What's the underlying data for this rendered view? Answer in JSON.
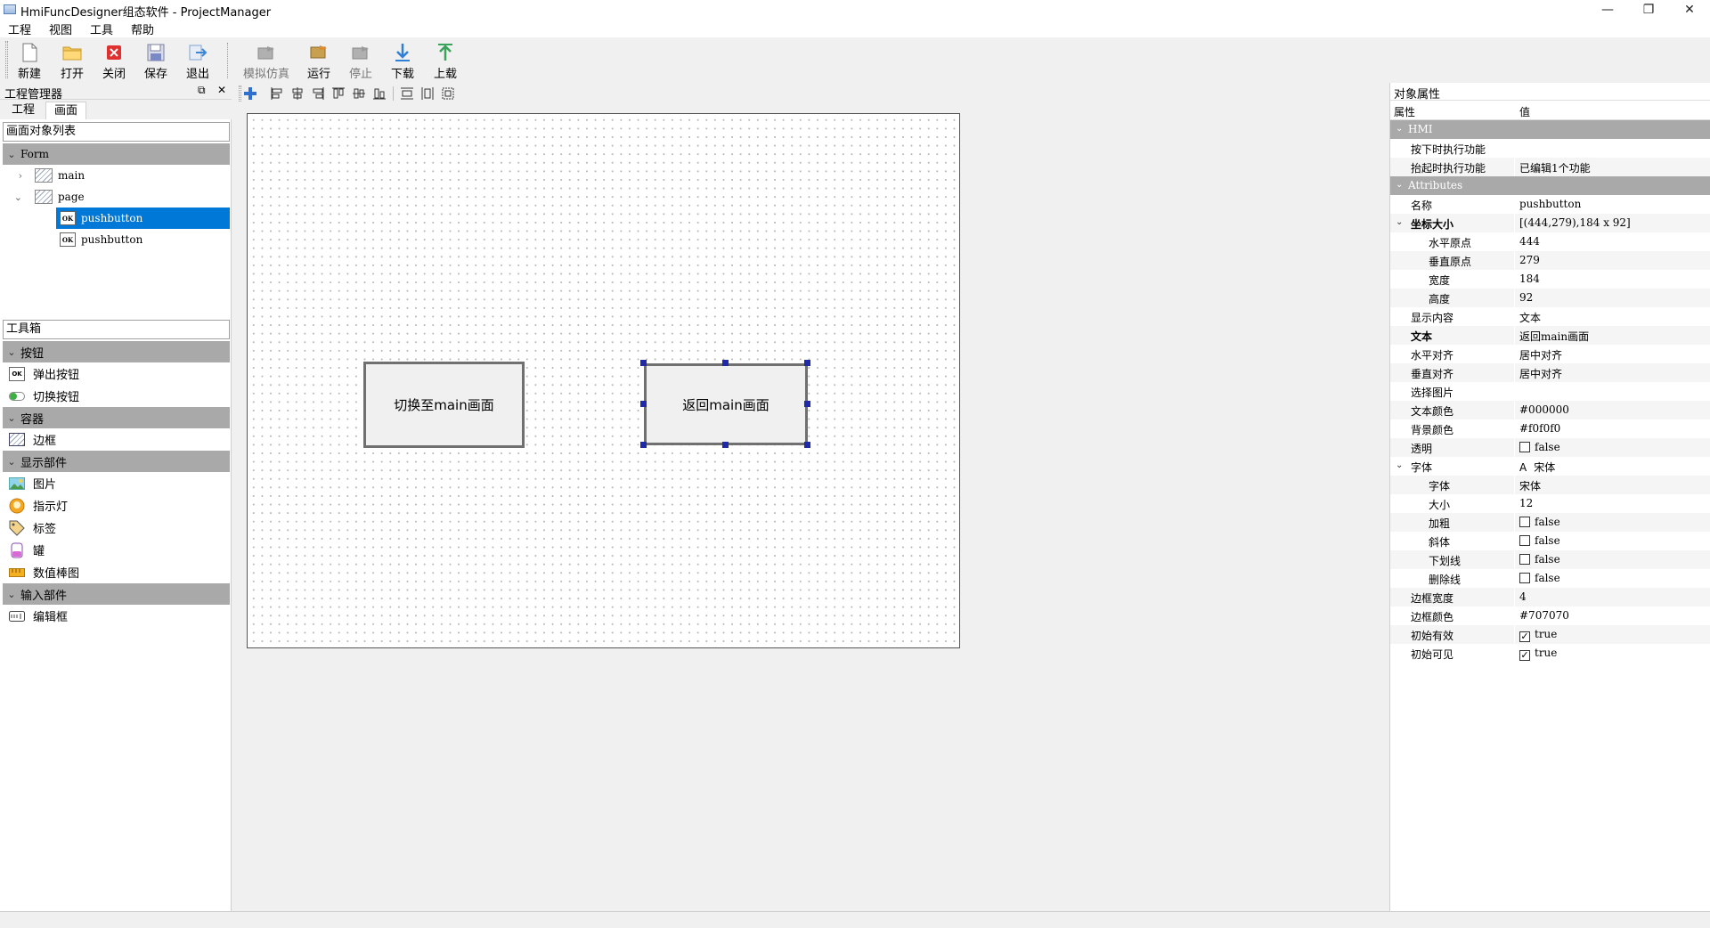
{
  "window": {
    "title": "HmiFuncDesigner组态软件 - ProjectManager",
    "controls": {
      "minimize": "—",
      "maximize": "❐",
      "close": "✕"
    }
  },
  "menu": [
    "工程",
    "视图",
    "工具",
    "帮助"
  ],
  "toolbar": {
    "new": "新建",
    "open": "打开",
    "close": "关闭",
    "save": "保存",
    "exit": "退出",
    "simulate": "模拟仿真",
    "run": "运行",
    "stop": "停止",
    "download": "下载",
    "upload": "上载"
  },
  "left": {
    "dock_title": "工程管理器",
    "dock_float_icon": "⧉",
    "dock_close_icon": "✕",
    "tabs": [
      "工程",
      "画面"
    ],
    "object_list_header": "画面对象列表",
    "tree": {
      "root": "Form",
      "items": [
        {
          "label": "main",
          "expanded": false
        },
        {
          "label": "page",
          "expanded": true,
          "children": [
            "pushbutton",
            "pushbutton"
          ]
        }
      ]
    },
    "toolbox_header": "工具箱",
    "groups": {
      "buttons": {
        "title": "按钮",
        "items": [
          "弹出按钮",
          "切换按钮"
        ]
      },
      "containers": {
        "title": "容器",
        "items": [
          "边框"
        ]
      },
      "display": {
        "title": "显示部件",
        "items": [
          "图片",
          "指示灯",
          "标签",
          "罐",
          "数值棒图"
        ]
      },
      "input": {
        "title": "输入部件",
        "items": [
          "编辑框"
        ]
      }
    }
  },
  "canvas": {
    "buttons": [
      {
        "text": "切换至main画面",
        "selected": false
      },
      {
        "text": "返回main画面",
        "selected": true
      }
    ]
  },
  "right": {
    "title": "对象属性",
    "col_property": "属性",
    "col_value": "值",
    "groups": {
      "hmi": "HMI",
      "attributes": "Attributes"
    },
    "props": {
      "press_func": {
        "k": "按下时执行功能",
        "v": ""
      },
      "release_func": {
        "k": "抬起时执行功能",
        "v": "已编辑1个功能"
      },
      "name": {
        "k": "名称",
        "v": "pushbutton"
      },
      "geometry": {
        "k": "坐标大小",
        "v": "[(444,279),184 x 92]"
      },
      "x": {
        "k": "水平原点",
        "v": "444"
      },
      "y": {
        "k": "垂直原点",
        "v": "279"
      },
      "width": {
        "k": "宽度",
        "v": "184"
      },
      "height": {
        "k": "高度",
        "v": "92"
      },
      "show_content": {
        "k": "显示内容",
        "v": "文本"
      },
      "text": {
        "k": "文本",
        "v": "返回main画面"
      },
      "halign": {
        "k": "水平对齐",
        "v": "居中对齐"
      },
      "valign": {
        "k": "垂直对齐",
        "v": "居中对齐"
      },
      "image": {
        "k": "选择图片",
        "v": ""
      },
      "text_color": {
        "k": "文本颜色",
        "v": "#000000"
      },
      "bg_color": {
        "k": "背景颜色",
        "v": "#f0f0f0"
      },
      "transparent": {
        "k": "透明",
        "v": "false"
      },
      "font": {
        "k": "字体",
        "v": "宋体",
        "icon": "A"
      },
      "font_family": {
        "k": "字体",
        "v": "宋体"
      },
      "font_size": {
        "k": "大小",
        "v": "12"
      },
      "bold": {
        "k": "加粗",
        "v": "false"
      },
      "italic": {
        "k": "斜体",
        "v": "false"
      },
      "underline": {
        "k": "下划线",
        "v": "false"
      },
      "strike": {
        "k": "删除线",
        "v": "false"
      },
      "border_width": {
        "k": "边框宽度",
        "v": "4"
      },
      "border_color": {
        "k": "边框颜色",
        "v": "#707070"
      },
      "enabled": {
        "k": "初始有效",
        "v": "true"
      },
      "visible": {
        "k": "初始可见",
        "v": "true"
      }
    }
  },
  "colors": {
    "selection": "#0078d7",
    "group_header": "#a9a9a9",
    "handle": "#1e2aa8"
  }
}
